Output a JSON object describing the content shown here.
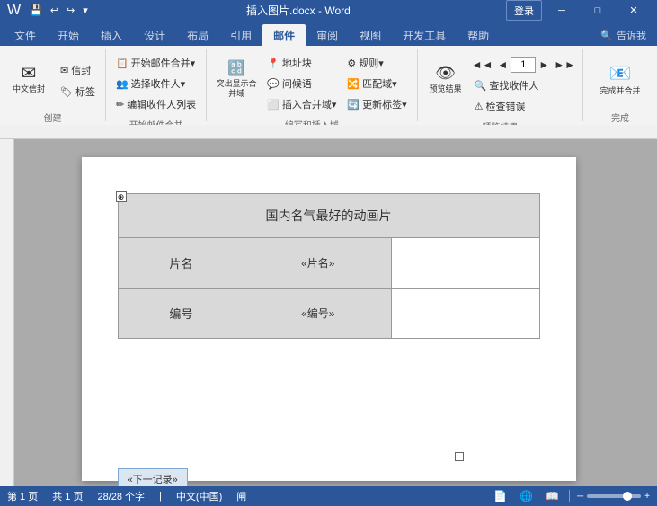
{
  "titleBar": {
    "title": "插入图片.docx - Word",
    "loginBtn": "登录",
    "minimizeBtn": "─",
    "maximizeBtn": "□",
    "closeBtn": "✕"
  },
  "quickAccess": {
    "save": "💾",
    "undo": "↩",
    "redo": "↪",
    "customize": "▾"
  },
  "tabs": [
    {
      "label": "文件"
    },
    {
      "label": "开始"
    },
    {
      "label": "插入"
    },
    {
      "label": "设计"
    },
    {
      "label": "布局"
    },
    {
      "label": "引用"
    },
    {
      "label": "邮件",
      "active": true
    },
    {
      "label": "审阅"
    },
    {
      "label": "视图"
    },
    {
      "label": "开发工具"
    },
    {
      "label": "帮助"
    }
  ],
  "tellInput": {
    "placeholder": "告诉我",
    "icon": "🔍"
  },
  "groups": {
    "create": {
      "label": "创建",
      "envelope": "信封",
      "label_btn": "标签",
      "chineseEnv": "中文信封"
    },
    "startMerge": {
      "label": "开始邮件合并",
      "startMerge": "开始邮件合并▾",
      "selectRecipient": "选择收件人▾",
      "editRecipientList": "编辑收件人列表"
    },
    "writeInsert": {
      "label": "编写和插入域",
      "highlight": "突出显示合并域",
      "addressBlock": "地址块",
      "greetingLine": "问候语",
      "insertField": "插入合并域▾",
      "rules": "规则▾",
      "matchFields": "匹配域▾",
      "updateLabels": "更新标签▾"
    },
    "preview": {
      "label": "预览结果",
      "previewBtn": "预览结果",
      "findRecipient": "查找收件人",
      "checkErrors": "检查错误",
      "prevBtn": "◄◄",
      "prevOne": "◄",
      "nextOne": "►",
      "nextBtn": "►►",
      "pageNum": "1"
    },
    "complete": {
      "label": "完成",
      "finishMerge": "完成并合并"
    }
  },
  "document": {
    "tableTitle": "国内名气最好的动画片",
    "row1Label": "片名",
    "row1Field": "«片名»",
    "row2Label": "编号",
    "row2Field": "«编号»",
    "nextRecordBtn": "«下一记录»"
  },
  "statusBar": {
    "page": "第 1 页",
    "of": "共 1 页",
    "chars": "28/28 个字",
    "lang": "中文(中国)",
    "proofing": "闸",
    "zoomLevel": "—",
    "zoomPercent": "—"
  }
}
